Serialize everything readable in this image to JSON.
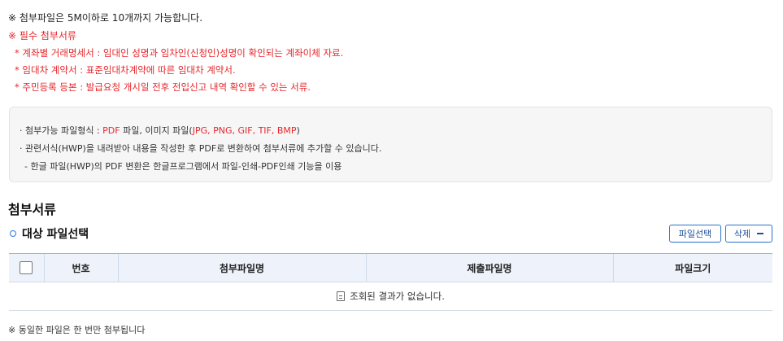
{
  "notice": {
    "top": "※ 첨부파일은 5M이하로 10개까지 가능합니다.",
    "required_title": "※ 필수 첨부서류",
    "required_items": [
      "* 계좌별 거래명세서 : 임대인 성명과 임차인(신청인)성명이 확인되는 계좌이체 자료.",
      "* 임대차 계약서 : 표준임대차계약에 따른 임대차 계약서.",
      "* 주민등록 등본 : 발급요청 개시일 전후 전입신고 내역 확인할 수 있는 서류."
    ]
  },
  "info": {
    "line1_prefix": "· 첨부가능 파일형식 : ",
    "line1_pdf": "PDF",
    "line1_mid": " 파일, 이미지 파일(",
    "line1_types": "JPG, PNG, GIF, TIF, BMP",
    "line1_suffix": ")",
    "line2": "· 관련서식(HWP)을 내려받아 내용을 작성한 후 PDF로 변환하여 첨부서류에 추가할 수 있습니다.",
    "line3": "- 한글 파일(HWP)의 PDF 변환은 한글프로그램에서 파일-인쇄-PDF인쇄 기능을 이용"
  },
  "section_title": "첨부서류",
  "sub_title": "대상 파일선택",
  "buttons": {
    "file_select": "파일선택",
    "delete": "삭제"
  },
  "table": {
    "headers": [
      "번호",
      "첨부파일명",
      "제출파일명",
      "파일크기"
    ],
    "empty_message": "조회된 결과가 없습니다."
  },
  "bottom_note": "※ 동일한 파일은 한 번만 첨부됩니다",
  "colors": {
    "accent_red": "#e8262b",
    "accent_blue": "#2b73c9",
    "header_bg": "#eef3fb"
  }
}
